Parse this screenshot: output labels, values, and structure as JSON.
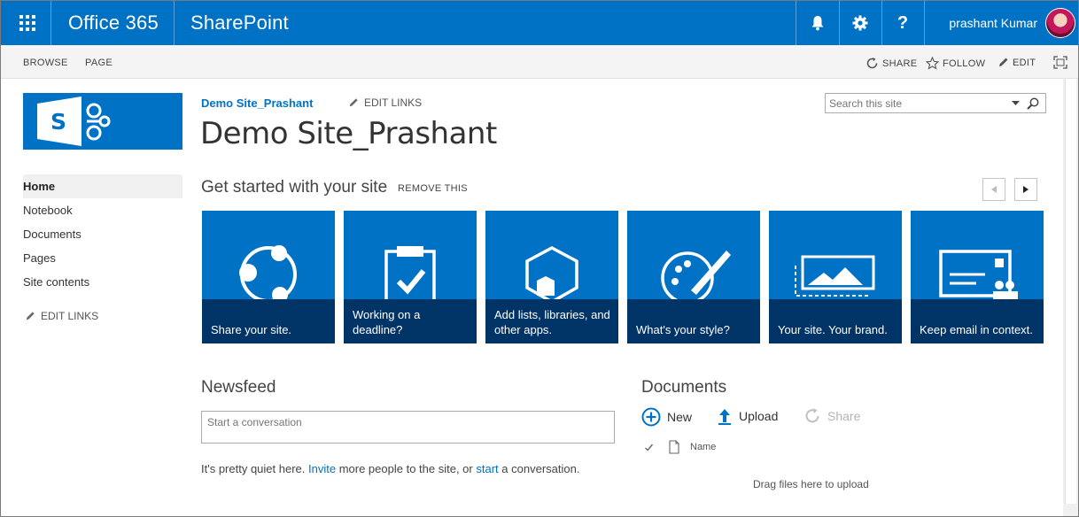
{
  "suite_bar": {
    "brand": "Office 365",
    "app": "SharePoint",
    "user_name": "prashant Kumar",
    "icons": [
      "waffle-icon",
      "bell-icon",
      "gear-icon",
      "help-icon"
    ],
    "color": "#0072c6"
  },
  "ribbon": {
    "tabs": [
      "BROWSE",
      "PAGE"
    ],
    "actions": {
      "share": "SHARE",
      "follow": "FOLLOW",
      "edit": "EDIT"
    }
  },
  "header": {
    "breadcrumb": "Demo Site_Prashant",
    "edit_links": "EDIT LINKS",
    "title": "Demo Site_Prashant",
    "search_placeholder": "Search this site"
  },
  "left_nav": {
    "items": [
      "Home",
      "Notebook",
      "Documents",
      "Pages",
      "Site contents"
    ],
    "active": "Home",
    "edit_links": "EDIT LINKS"
  },
  "get_started": {
    "title": "Get started with your site",
    "remove": "REMOVE THIS",
    "tiles": [
      {
        "caption": "Share your site.",
        "icon": "share-network-icon"
      },
      {
        "caption": "Working on a deadline?",
        "icon": "clipboard-check-icon"
      },
      {
        "caption": "Add lists, libraries, and other apps.",
        "icon": "apps-hexagon-icon"
      },
      {
        "caption": "What's your style?",
        "icon": "palette-brush-icon"
      },
      {
        "caption": "Your site. Your brand.",
        "icon": "image-frame-icon"
      },
      {
        "caption": "Keep email in context.",
        "icon": "email-contacts-icon"
      }
    ]
  },
  "newsfeed": {
    "title": "Newsfeed",
    "placeholder": "Start a conversation",
    "quiet_pre": "It's pretty quiet here.",
    "invite": "Invite",
    "quiet_mid": "more people to the site, or",
    "start": "start",
    "quiet_post": "a conversation."
  },
  "documents": {
    "title": "Documents",
    "new": "New",
    "upload": "Upload",
    "share": "Share",
    "column_name": "Name",
    "drag_text": "Drag files here to upload"
  }
}
